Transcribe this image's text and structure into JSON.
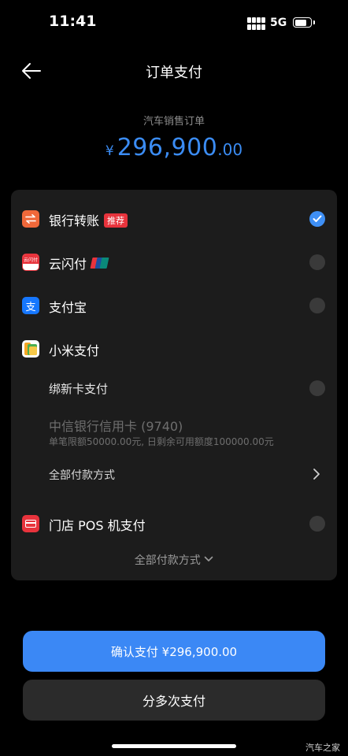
{
  "status_bar": {
    "time": "11:41",
    "network": "5G",
    "battery_level": 0.76
  },
  "header": {
    "title": "订单支付",
    "back_icon": "arrow-left-icon"
  },
  "order": {
    "label": "汽车销售订单",
    "currency": "¥",
    "amount_int": "296,900",
    "amount_dec": ".00"
  },
  "methods": {
    "bank_transfer": {
      "label": "银行转账",
      "tag": "推荐",
      "icon": "transfer-icon",
      "icon_color": "#f0683a",
      "selected": true
    },
    "cloud_quickpass": {
      "label": "云闪付",
      "icon": "cloud-quickpass-icon",
      "icon_color": "#e8333c",
      "icon_text": "云闪付"
    },
    "alipay": {
      "label": "支付宝",
      "icon": "alipay-icon",
      "icon_color": "#1677ff",
      "icon_text": "支"
    },
    "xiaomi_pay": {
      "label": "小米支付",
      "icon": "xiaomi-pay-icon",
      "bind_card": "绑新卡支付",
      "citic_card": "中信银行信用卡 (9740)",
      "citic_limit": "单笔限额50000.00元, 日剩余可用额度100000.00元",
      "all_methods": "全部付款方式"
    },
    "pos": {
      "label": "门店 POS 机支付",
      "icon": "pos-card-icon",
      "icon_color": "#e8333c"
    }
  },
  "more_methods": "全部付款方式",
  "buttons": {
    "confirm": "确认支付 ¥296,900.00",
    "split": "分多次支付"
  },
  "watermark": "汽车之家",
  "colors": {
    "accent": "#3b88f5",
    "tag_red": "#e8333c",
    "card_bg": "#1c1c1c"
  }
}
